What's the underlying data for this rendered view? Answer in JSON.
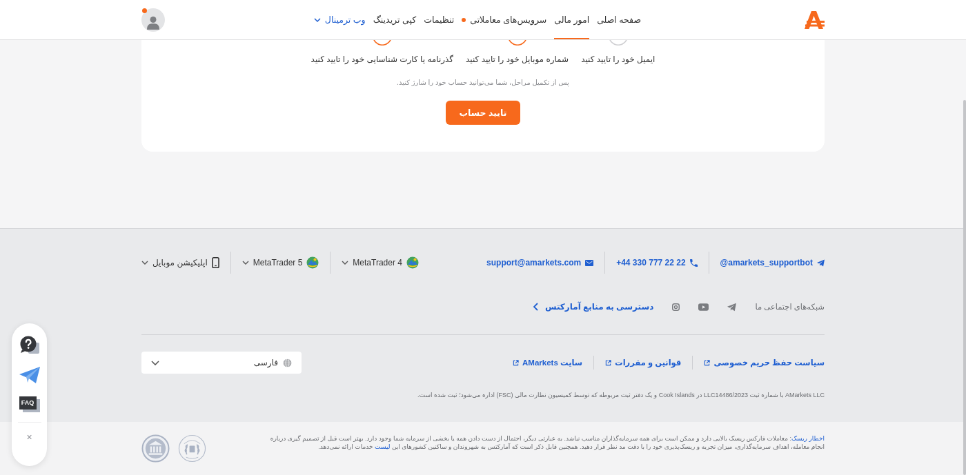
{
  "header": {
    "nav": [
      {
        "label": "صفحه اصلی",
        "selected": false,
        "dot": false,
        "kind": "link"
      },
      {
        "label": "امور مالی",
        "selected": true,
        "dot": false,
        "kind": "link"
      },
      {
        "label": "سرویس‌های معاملاتی",
        "selected": false,
        "dot": true,
        "kind": "link"
      },
      {
        "label": "تنظیمات",
        "selected": false,
        "dot": false,
        "kind": "link"
      },
      {
        "label": "کپی تریدینگ",
        "selected": false,
        "dot": false,
        "kind": "link"
      },
      {
        "label": "وب ترمینال",
        "selected": false,
        "dot": false,
        "kind": "dropdown"
      }
    ],
    "avatar": {
      "notification": true
    }
  },
  "verification": {
    "steps": [
      {
        "label": "ایمیل خود را تایید کنید",
        "active": false
      },
      {
        "label": "شماره موبایل خود را تایید کنید",
        "active": true
      },
      {
        "label": "گذرنامه یا کارت شناسایی خود را تایید کنید",
        "active": true
      }
    ],
    "note": "پس از تکمیل مراحل، شما می‌توانید حساب خود را شارژ کنید.",
    "button": "تایید حساب"
  },
  "footer": {
    "contacts": [
      {
        "kind": "telegram",
        "label": "@amarkets_supportbot"
      },
      {
        "kind": "phone",
        "label": "+44 330 777 22 22"
      },
      {
        "kind": "email",
        "label": "support@amarkets.com"
      }
    ],
    "downloads": [
      {
        "kind": "metatrader",
        "label": "MetaTrader 4"
      },
      {
        "kind": "metatrader",
        "label": "MetaTrader 5"
      },
      {
        "kind": "mobile",
        "label": "اپلیکیشن موبایل"
      }
    ],
    "social_label": "شبکه‌های اجتماعی ما",
    "resources_link": "دسترسی به منابع آمارکتس",
    "legal_links": [
      "سیاست حفظ حریم خصوصی",
      "قوانین و مقررات",
      "سایت AMarkets"
    ],
    "language": {
      "value": "فارسی"
    },
    "registration": "AMarkets LLC با شماره ثبت LLC14486/2023 در Cook Islands و یک دفتر ثبت مربوطه که توسط کمیسیون نظارت مالی (FSC) اداره می‌شود؛ ثبت شده است."
  },
  "risk_warning": {
    "label": "اخطار ریسک",
    "text": ": معاملات فارکس ریسک بالایی دارد و ممکن است برای همه سرمایه‌گذاران مناسب نباشد. به عبارتی دیگر، احتمال از دست دادن همه یا بخشی از سرمایه شما وجود دارد. بهتر است قبل از تصمیم گیری درباره انجام معامله، اهداف سرمایه‌گذاری، میزان تجربه و ریسک‌پذیری خود را با دقت مد نظر قرار دهید. همچنین قابل ذکر است که آمارکتس به شهروندان و ساکنین کشورهای این",
    "link": "لیست",
    "text_end": "خدمات ارائه نمی‌دهد."
  },
  "chat_widget": {
    "faq": "FAQ",
    "close": "×"
  }
}
